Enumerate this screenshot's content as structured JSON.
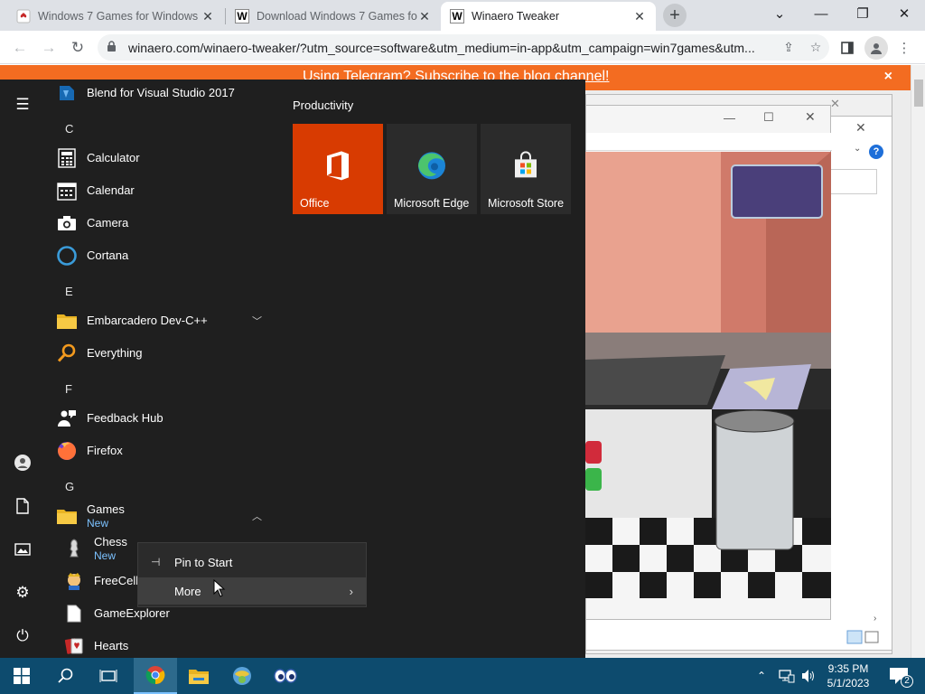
{
  "browser": {
    "tabs": [
      {
        "title": "Windows 7 Games for Windows",
        "favicon": "W7"
      },
      {
        "title": "Download Windows 7 Games fo",
        "favicon": "W"
      },
      {
        "title": "Winaero Tweaker",
        "favicon": "W"
      }
    ],
    "active_tab": 2,
    "url": "winaero.com/winaero-tweaker/?utm_source=software&utm_medium=in-app&utm_campaign=win7games&utm...",
    "banner_text": "Using Telegram? Subscribe to the blog channel!",
    "banner_close": "×"
  },
  "start_menu": {
    "letters": {
      "c": "C",
      "e": "E",
      "f": "F",
      "g": "G"
    },
    "apps": {
      "blend": "Blend for Visual Studio 2017",
      "calculator": "Calculator",
      "calendar": "Calendar",
      "camera": "Camera",
      "cortana": "Cortana",
      "embarcadero": "Embarcadero Dev-C++",
      "everything": "Everything",
      "feedback": "Feedback Hub",
      "firefox": "Firefox",
      "games": "Games",
      "games_new": "New",
      "chess": "Chess",
      "chess_new": "New",
      "freecell": "FreeCell",
      "gameexplorer": "GameExplorer",
      "hearts": "Hearts"
    },
    "group_title": "Productivity",
    "tiles": {
      "office": "Office",
      "edge": "Microsoft Edge",
      "store": "Microsoft Store"
    },
    "colors": {
      "office_tile": "#d83b01",
      "menu_bg": "#1f1f1f",
      "accent_text": "#7cc2ff"
    }
  },
  "context_menu": {
    "pin": "Pin to Start",
    "more": "More"
  },
  "taskbar": {
    "time": "9:35 PM",
    "date": "5/1/2023",
    "notifications": "2"
  }
}
